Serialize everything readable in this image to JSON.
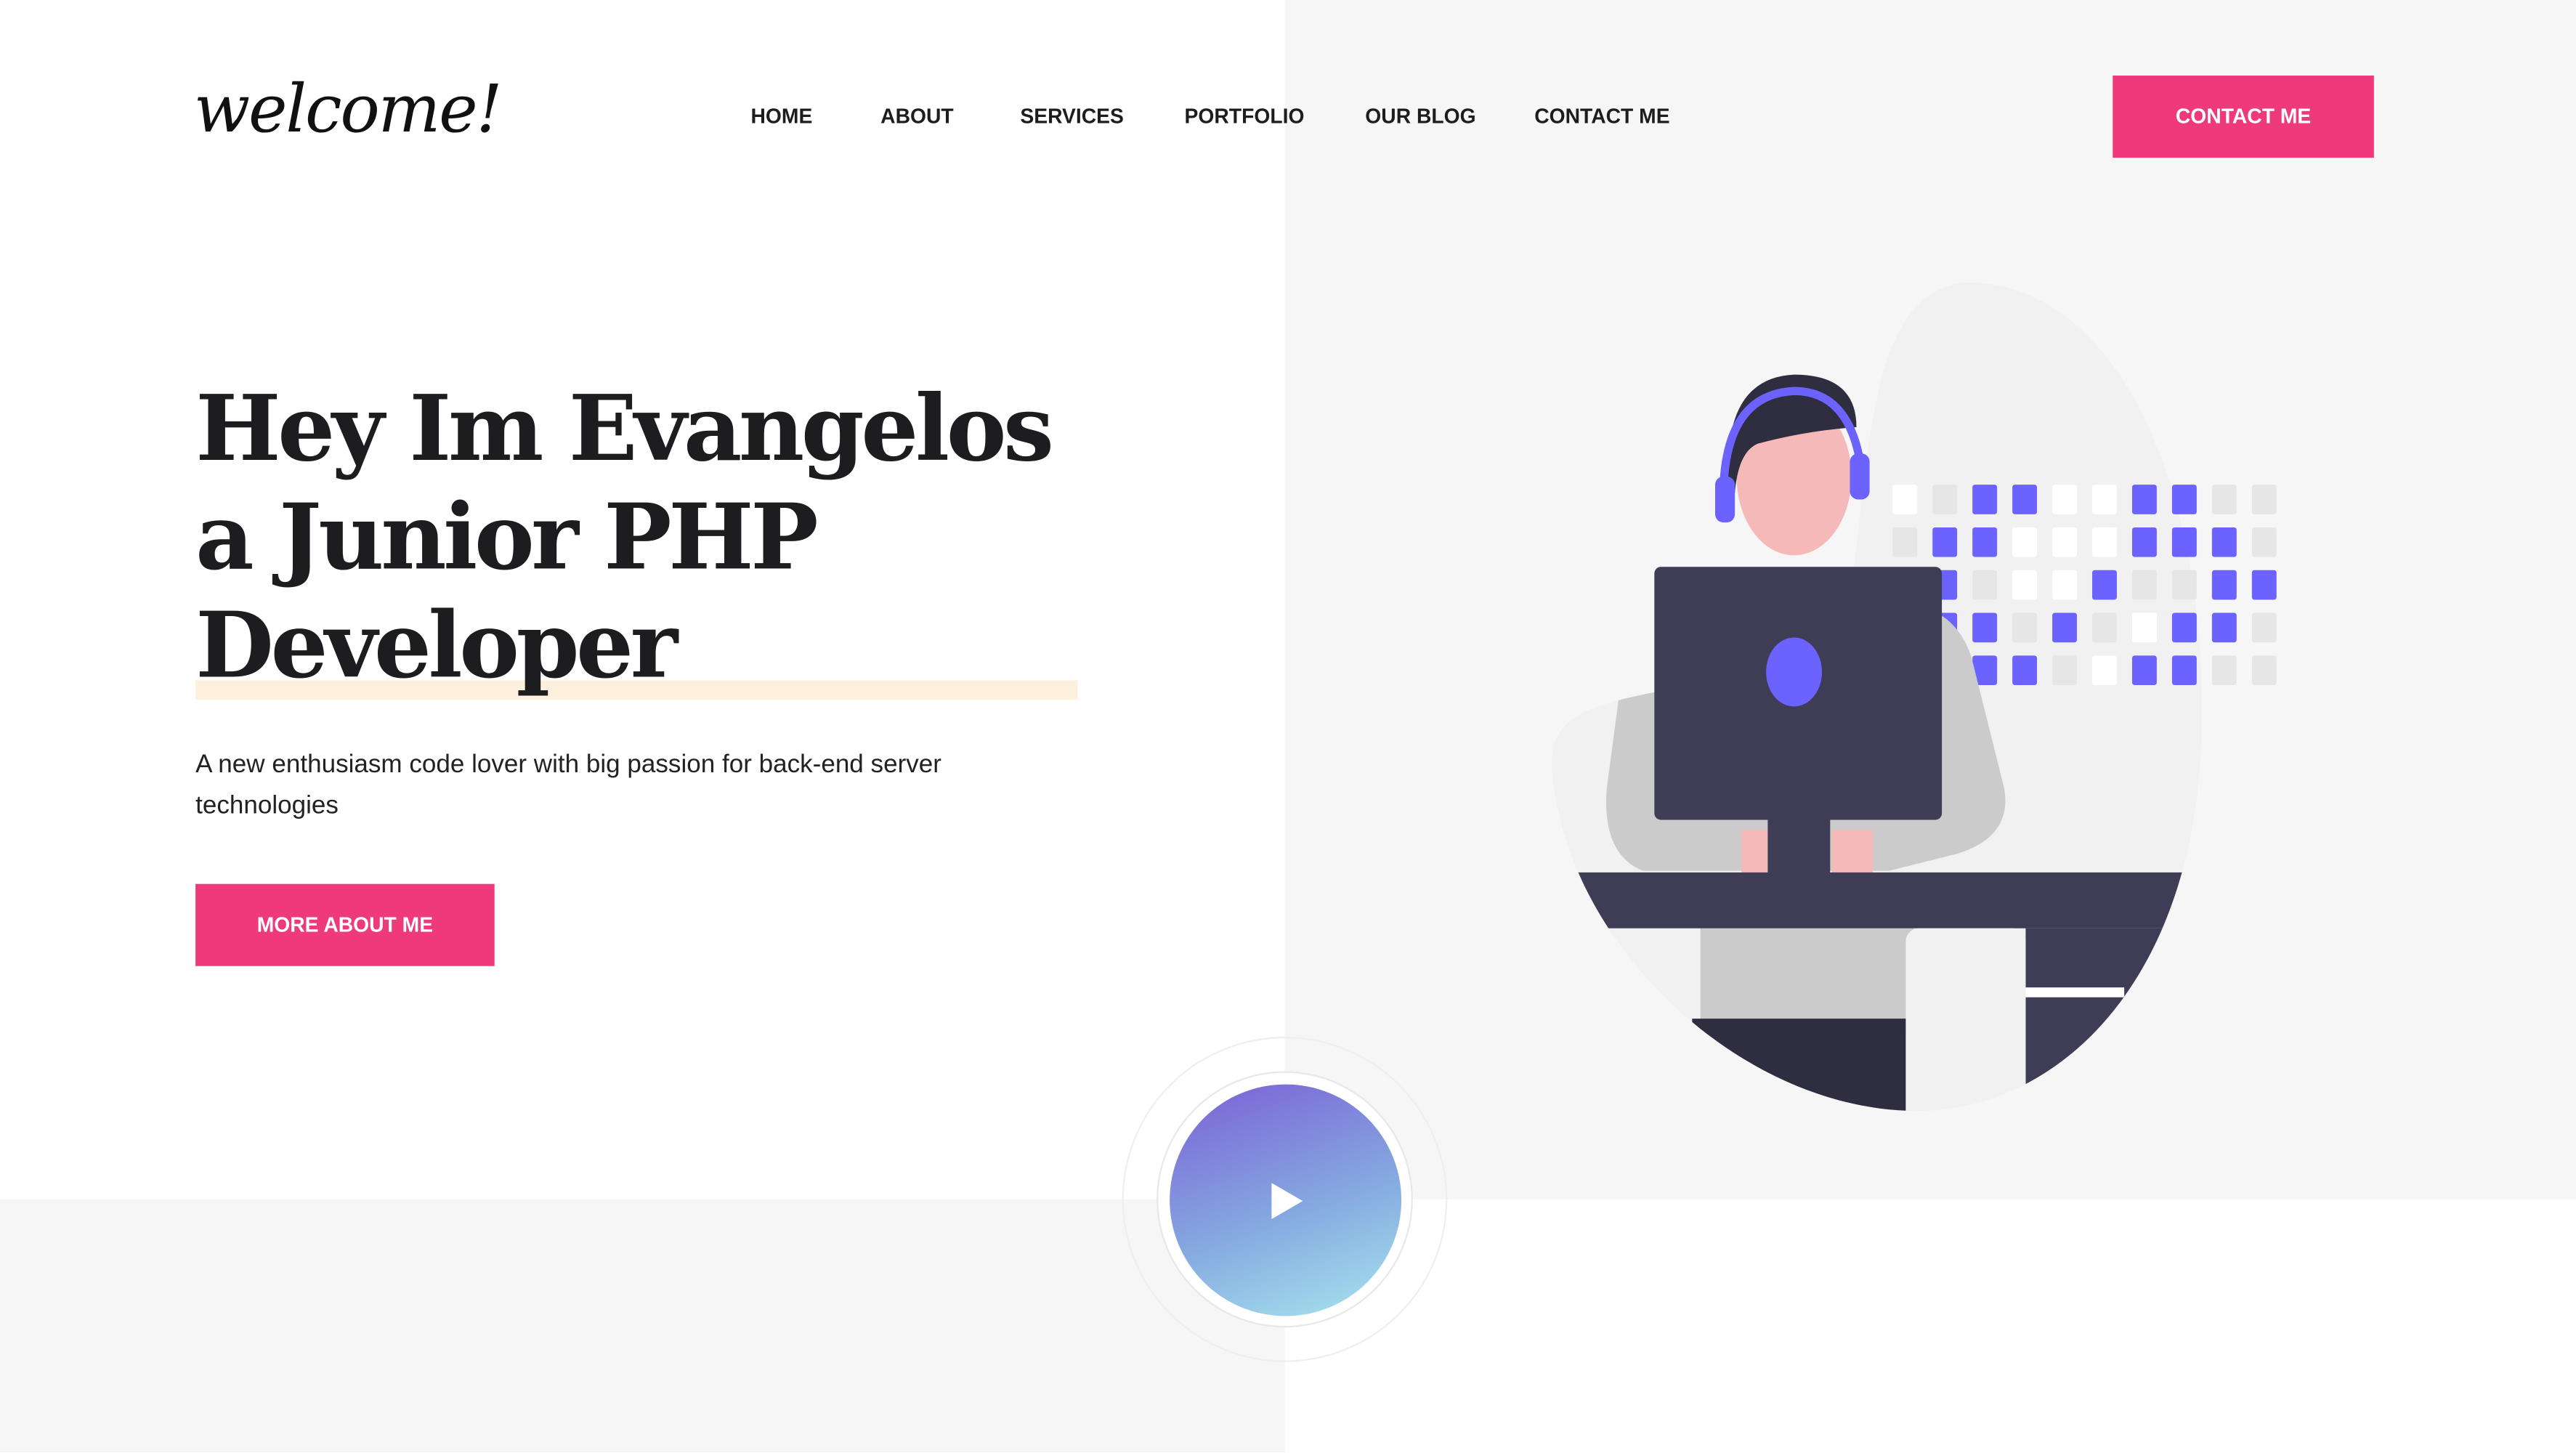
{
  "logo": {
    "text": "welcome!"
  },
  "nav": {
    "items": [
      {
        "label": "HOME"
      },
      {
        "label": "ABOUT"
      },
      {
        "label": "SERVICES"
      },
      {
        "label": "PORTFOLIO"
      },
      {
        "label": "OUR BLOG"
      },
      {
        "label": "CONTACT ME"
      }
    ]
  },
  "header": {
    "cta_label": "CONTACT ME"
  },
  "hero": {
    "title": "Hey Im Evangelos a Junior PHP Developer",
    "subtitle": "A new enthusiasm code lover with big passion for back-end server technologies",
    "button_label": "MORE ABOUT ME"
  },
  "video": {
    "icon": "play-icon"
  },
  "colors": {
    "accent": "#ee3a7a",
    "illustration_purple": "#6c63ff",
    "illustration_dark": "#3f3d56"
  }
}
